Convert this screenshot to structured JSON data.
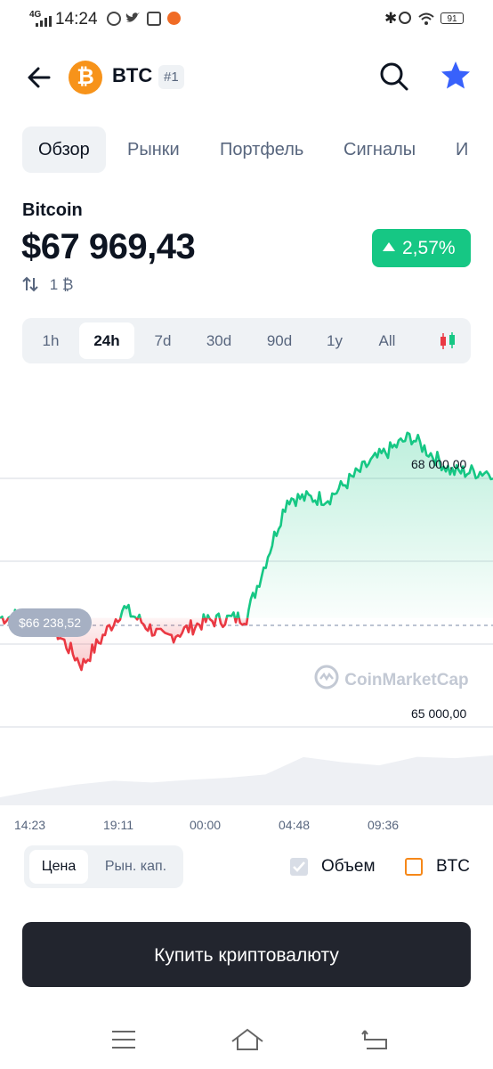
{
  "status_bar": {
    "time": "14:24",
    "network": "4G",
    "battery": "91"
  },
  "header": {
    "symbol": "BTC",
    "rank": "#1",
    "logo_glyph": "₿"
  },
  "tabs": [
    {
      "label": "Обзор",
      "active": true
    },
    {
      "label": "Рынки"
    },
    {
      "label": "Портфель"
    },
    {
      "label": "Сигналы"
    },
    {
      "label": "И"
    }
  ],
  "coin": {
    "name": "Bitcoin",
    "price": "$67 969,43",
    "change": "2,57%",
    "change_color": "#16c784",
    "volume_label": "1 ₿"
  },
  "ranges": [
    {
      "label": "1h"
    },
    {
      "label": "24h",
      "active": true
    },
    {
      "label": "7d"
    },
    {
      "label": "30d"
    },
    {
      "label": "90d"
    },
    {
      "label": "1y"
    },
    {
      "label": "All"
    }
  ],
  "chart": {
    "open_price_label": "$66 238,52",
    "y_tick_high": "68 000,00",
    "y_tick_low": "65 000,00",
    "watermark": "CoinMarketCap",
    "time_labels": [
      "14:23",
      "19:11",
      "00:00",
      "04:48",
      "09:36"
    ]
  },
  "chart_data": {
    "type": "area",
    "x": [
      "14:23",
      "19:11",
      "00:00",
      "04:48",
      "09:36"
    ],
    "series": [
      {
        "values": [
          66238,
          66300,
          65700,
          66350,
          66000,
          66200,
          66250,
          67600,
          67600,
          68000,
          68300,
          67900,
          67900
        ]
      }
    ],
    "ylim": [
      65000,
      68300
    ],
    "up_color": "#16c784",
    "down_color": "#ea3943"
  },
  "controls": {
    "segments": [
      {
        "label": "Цена",
        "active": true
      },
      {
        "label": "Рын. кап."
      }
    ],
    "volume_label": "Объем",
    "btc_label": "BTC"
  },
  "buy_button": "Купить криптовалюту"
}
